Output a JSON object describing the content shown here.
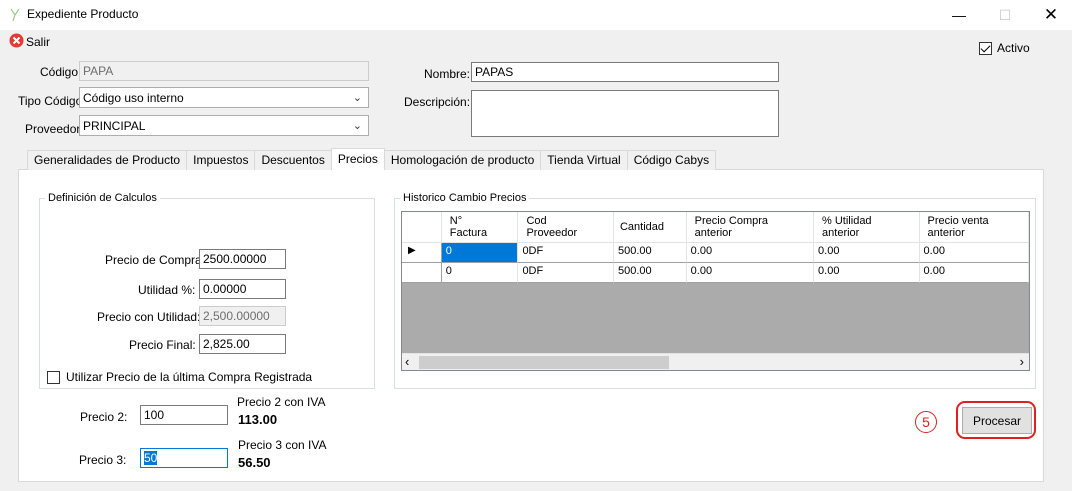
{
  "window": {
    "title": "Expediente Producto",
    "minimize": "—",
    "maximize": "☐",
    "close": "✕"
  },
  "toolbar": {
    "salir_label": "Salir"
  },
  "activo": {
    "label": "Activo",
    "checked": true
  },
  "header": {
    "codigo_label": "Código:",
    "codigo_value": "PAPA",
    "tipo_codigo_label": "Tipo Código:",
    "tipo_codigo_value": "Código uso interno",
    "proveedor_label": "Proveedor:",
    "proveedor_value": "PRINCIPAL",
    "nombre_label": "Nombre:",
    "nombre_value": "PAPAS",
    "descripcion_label": "Descripción:",
    "descripcion_value": ""
  },
  "tabs": [
    {
      "label": "Generalidades de Producto"
    },
    {
      "label": "Impuestos"
    },
    {
      "label": "Descuentos"
    },
    {
      "label": "Precios"
    },
    {
      "label": "Homologación de producto"
    },
    {
      "label": "Tienda Virtual"
    },
    {
      "label": "Código Cabys"
    }
  ],
  "active_tab": "Precios",
  "calculos": {
    "group_title": "Definición de Calculos",
    "precio_compra_label": "Precio de Compra:",
    "precio_compra_value": "2500.00000",
    "utilidad_label": "Utilidad %:",
    "utilidad_value": "0.00000",
    "precio_utilidad_label": "Precio con Utilidad:",
    "precio_utilidad_value": "2,500.00000",
    "precio_final_label": "Precio Final:",
    "precio_final_value": "2,825.00",
    "ultima_compra_label": "Utilizar Precio de la última Compra Registrada",
    "ultima_compra_checked": false
  },
  "precios_extra": {
    "precio2_label": "Precio 2:",
    "precio2_value": "100",
    "precio2_iva_label": "Precio 2 con IVA",
    "precio2_iva_value": "113.00",
    "precio3_label": "Precio 3:",
    "precio3_value": "50",
    "precio3_iva_label": "Precio 3 con IVA",
    "precio3_iva_value": "56.50"
  },
  "historico": {
    "group_title": "Historico Cambio Precios",
    "columns": [
      {
        "line1": "N°",
        "line2": "Factura"
      },
      {
        "line1": "Cod",
        "line2": "Proveedor"
      },
      {
        "line1": "Cantidad",
        "line2": ""
      },
      {
        "line1": "Precio Compra",
        "line2": "anterior"
      },
      {
        "line1": "% Utilidad",
        "line2": "anterior"
      },
      {
        "line1": "Precio venta",
        "line2": "anterior"
      }
    ],
    "rows": [
      [
        "0",
        "0DF",
        "500.00",
        "0.00",
        "0.00",
        "0.00"
      ],
      [
        "0",
        "0DF",
        "500.00",
        "0.00",
        "0.00",
        "0.00"
      ]
    ],
    "scroll_left": "‹",
    "scroll_right": "›"
  },
  "actions": {
    "procesar_label": "Procesar",
    "step_marker": "5"
  },
  "colors": {
    "selection": "#0078d7",
    "highlight": "#e02020",
    "grid_empty": "#ababab"
  }
}
